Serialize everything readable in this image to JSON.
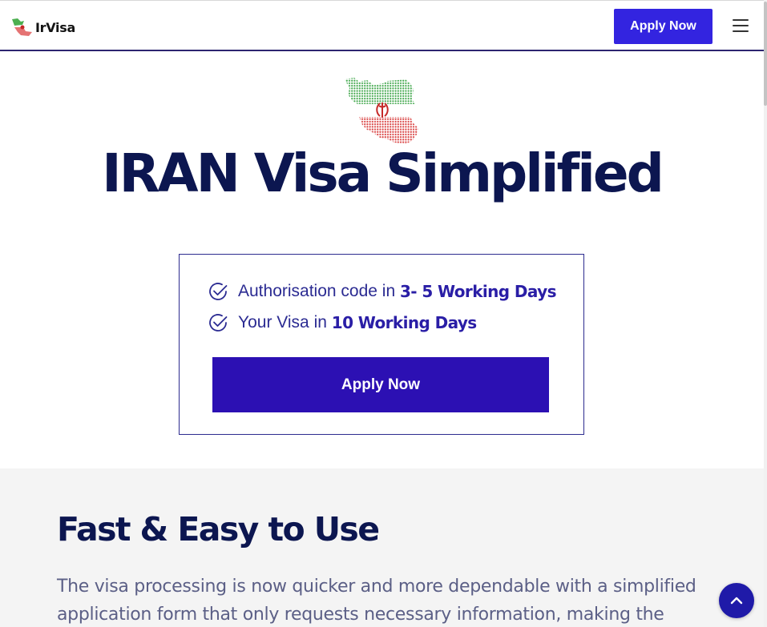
{
  "header": {
    "logo_text": "IrVisa",
    "apply_label": "Apply Now",
    "menu_icon": "hamburger-menu-icon"
  },
  "hero": {
    "map_icon": "iran-flag-map-icon",
    "title": "IRAN Visa Simplified",
    "features": [
      {
        "icon": "check-circle-icon",
        "text": "Authorisation code in ",
        "highlight": "3- 5 Working Days"
      },
      {
        "icon": "check-circle-icon",
        "text": "Your Visa in ",
        "highlight": "10 Working Days"
      }
    ],
    "apply_label": "Apply Now"
  },
  "section2": {
    "title": "Fast & Easy to Use",
    "text": "The visa processing is now quicker and more dependable with a simplified application form that only requests necessary information, making the"
  },
  "scroll_top_icon": "chevron-up-icon",
  "colors": {
    "brand_blue": "#3324e0",
    "box_button": "#2c10b3",
    "heading_navy": "#0c1650",
    "flag_green": "#3fa34d",
    "flag_red": "#d63a3a"
  }
}
